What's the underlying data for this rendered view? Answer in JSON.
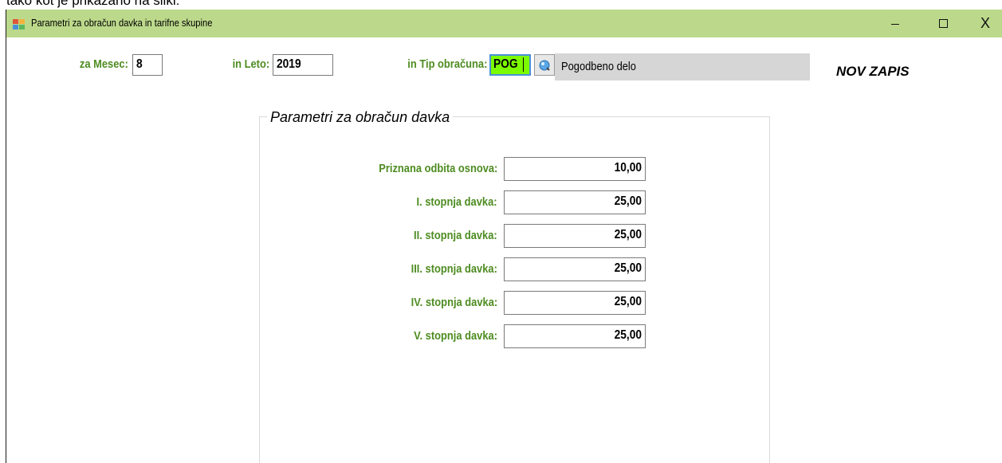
{
  "document_text": "tako kot je prikazano na sliki:",
  "window": {
    "title": "Parametri za obračun davka in tarifne skupine",
    "controls": {
      "minimize": "–",
      "maximize": "☐",
      "close": "X"
    }
  },
  "header": {
    "mesec_label": "za Mesec:",
    "mesec_value": "8",
    "leto_label": "in Leto:",
    "leto_value": "2019",
    "tip_label": "in Tip obračuna:",
    "tip_value": "POG",
    "tip_description": "Pogodbeno delo",
    "status": "NOV ZAPIS"
  },
  "group": {
    "title": "Parametri za obračun davka",
    "params": [
      {
        "label": "Priznana odbita osnova:",
        "value": "10,00"
      },
      {
        "label": "I. stopnja davka:",
        "value": "25,00"
      },
      {
        "label": "II. stopnja davka:",
        "value": "25,00"
      },
      {
        "label": "III. stopnja davka:",
        "value": "25,00"
      },
      {
        "label": "IV. stopnja davka:",
        "value": "25,00"
      },
      {
        "label": "V. stopnja davka:",
        "value": "25,00"
      }
    ]
  },
  "colors": {
    "titlebar": "#bcd98b",
    "label_green": "#4e8c21",
    "highlight_field": "#7cfc00",
    "description_bg": "#d6d6d6"
  },
  "icons": {
    "app": "form-window-icon",
    "lookup": "search-lookup-icon"
  }
}
